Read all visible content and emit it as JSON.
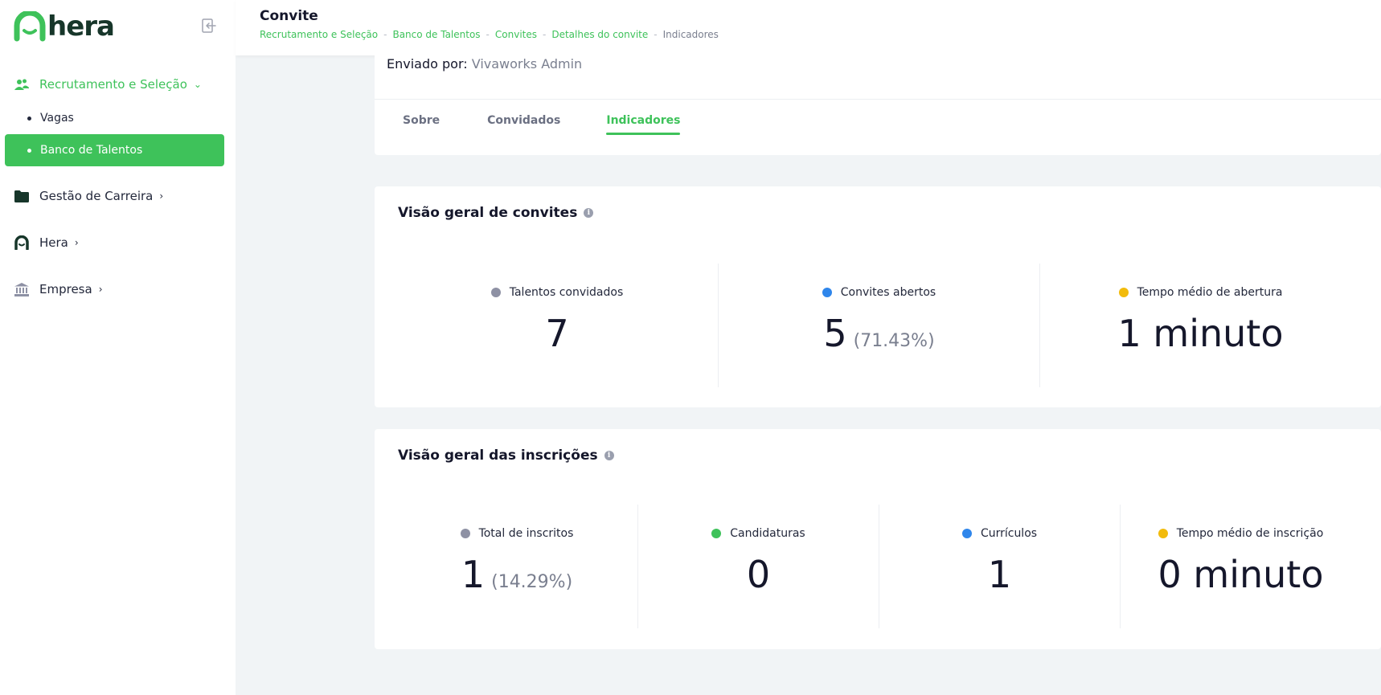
{
  "brand": {
    "name": "hera",
    "accent": "#3ec25a",
    "dark": "#17362a"
  },
  "sidebar": {
    "groups": [
      {
        "label": "Recrutamento e Seleção",
        "icon": "users-icon",
        "chevron": "⌄"
      },
      {
        "label": "Gestão de Carreira",
        "icon": "folder-icon",
        "chevron": "›"
      },
      {
        "label": "Hera",
        "icon": "hera-icon",
        "chevron": "›"
      },
      {
        "label": "Empresa",
        "icon": "bank-icon",
        "chevron": "›"
      }
    ],
    "subitems": [
      {
        "label": "Vagas"
      },
      {
        "label": "Banco de Talentos"
      }
    ]
  },
  "header": {
    "title": "Convite",
    "breadcrumb": [
      "Recrutamento e Seleção",
      "Banco de Talentos",
      "Convites",
      "Detalhes do convite",
      "Indicadores"
    ]
  },
  "invite": {
    "sender_label": "Enviado por:",
    "sender_value": "Vivaworks Admin",
    "tabs": [
      "Sobre",
      "Convidados",
      "Indicadores"
    ]
  },
  "overview_invites": {
    "title": "Visão geral de convites",
    "metrics": [
      {
        "label": "Talentos convidados",
        "value": "7",
        "pct": "",
        "color": "#8e91a4"
      },
      {
        "label": "Convites abertos",
        "value": "5",
        "pct": "(71.43%)",
        "color": "#2f86eb"
      },
      {
        "label": "Tempo médio de abertura",
        "value": "1 minuto",
        "pct": "",
        "color": "#f2bb0c"
      }
    ]
  },
  "overview_subscriptions": {
    "title": "Visão geral das inscrições",
    "metrics": [
      {
        "label": "Total de inscritos",
        "value": "1",
        "pct": "(14.29%)",
        "color": "#8e91a4"
      },
      {
        "label": "Candidaturas",
        "value": "0",
        "pct": "",
        "color": "#3ec25a"
      },
      {
        "label": "Currículos",
        "value": "1",
        "pct": "",
        "color": "#2f86eb"
      },
      {
        "label": "Tempo médio de inscrição",
        "value": "0 minuto",
        "pct": "",
        "color": "#f2bb0c"
      }
    ]
  }
}
